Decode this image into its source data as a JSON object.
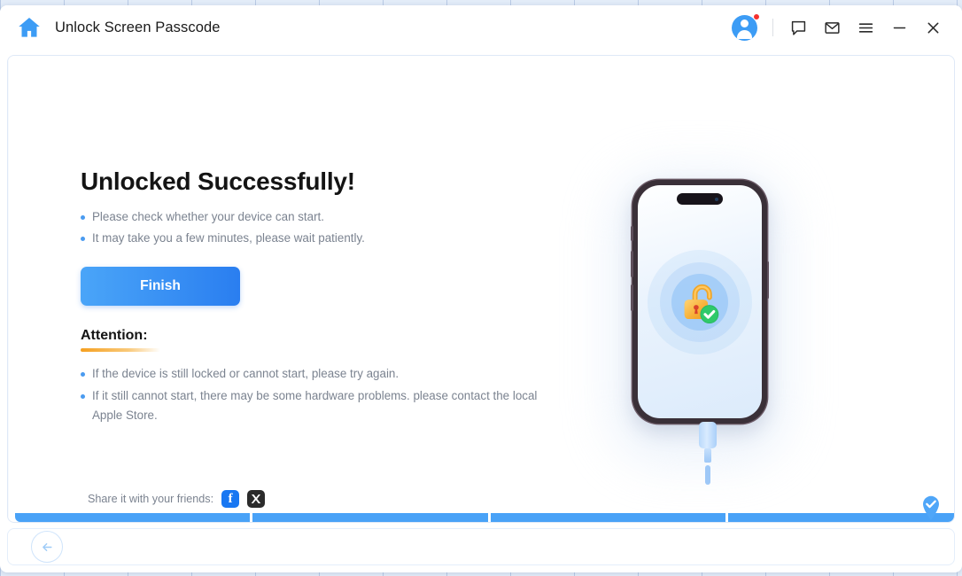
{
  "window": {
    "title": "Unlock Screen Passcode",
    "home_icon": "home-icon"
  },
  "titlebar_icons": {
    "account": "account-avatar-icon",
    "notification_dot": "notification-dot",
    "feedback": "chat-bubble-icon",
    "mail": "mail-envelope-icon",
    "menu": "hamburger-menu-icon",
    "minimize": "minimize-icon",
    "close": "close-icon"
  },
  "main": {
    "headline": "Unlocked Successfully!",
    "notes": [
      "Please check whether your device can start.",
      "It may take you a few minutes, please wait patiently."
    ],
    "finish_label": "Finish",
    "attention_title": "Attention:",
    "attention_notes": [
      "If the device is still locked or cannot start, please try again.",
      "If it still cannot start, there may be some hardware problems. please contact the local Apple Store."
    ]
  },
  "share": {
    "label": "Share it with your friends:",
    "facebook_glyph": "f",
    "facebook_name": "facebook-share-icon",
    "x_name": "x-twitter-share-icon"
  },
  "illustration": {
    "device": "iphone-illustration",
    "status_icon": "unlocked-padlock-icon",
    "success_badge": "green-check-badge",
    "cable": "usb-cable-icon"
  },
  "progress": {
    "segments": 4,
    "completed": 4,
    "badge": "progress-complete-check"
  },
  "footer": {
    "back_label": "back-arrow-icon"
  },
  "colors": {
    "accent_blue": "#49a2f7",
    "button_gradient_from": "#4aa5f8",
    "button_gradient_to": "#2a7ef0",
    "attention_orange": "#f5a020",
    "success_green": "#22c55e",
    "lock_orange": "#f5a623",
    "body_text": "#7b8390",
    "heading_text": "#141414",
    "facebook_blue": "#1877f2",
    "x_black": "#2b2b2b",
    "notification_red": "#f5312e"
  }
}
